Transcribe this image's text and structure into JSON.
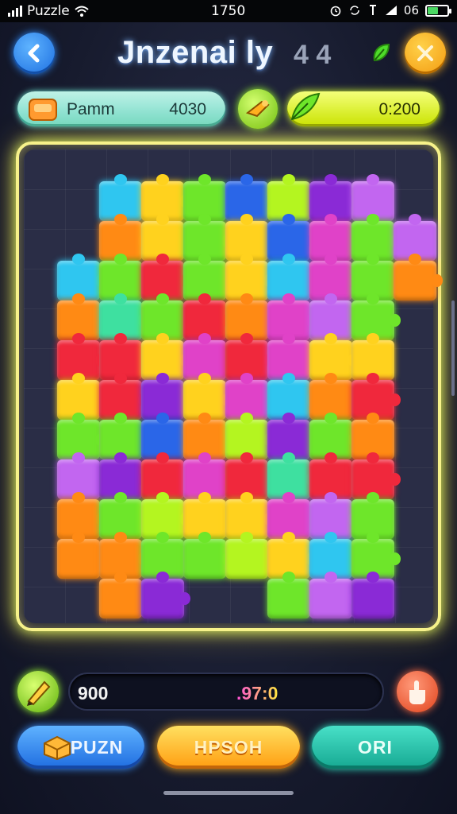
{
  "status_bar": {
    "carrier": "Puzzle",
    "time": "1750",
    "battery_text": "06",
    "battery_level": 0.55
  },
  "header": {
    "title": "Jnzenai ly",
    "title_suffix": "4 4",
    "back_icon": "chevron-left-icon",
    "close_icon": "close-icon"
  },
  "top_panels": {
    "left_label": "Pamm",
    "left_value": "4030",
    "right_value": "0:200",
    "left_icon": "bread-box-icon",
    "middle_icon": "puzzle-hand-icon",
    "right_icon": "leaf-icon"
  },
  "board": {
    "colors": {
      "cyan": "#2fc6f0",
      "yellow": "#ffd21e",
      "green": "#6ee62a",
      "lime": "#b4f520",
      "blue": "#2a66e8",
      "purple": "#8a2ad6",
      "violet": "#c266f0",
      "orange": "#ff8a14",
      "red": "#f0283c",
      "magenta": "#e042c8",
      "mint": "#3ee0a0"
    },
    "rows": [
      [
        "empty",
        "cyan",
        "yellow",
        "green",
        "blue",
        "lime",
        "purple",
        "violet",
        "empty"
      ],
      [
        "empty",
        "orange",
        "yellow",
        "green",
        "yellow",
        "blue",
        "magenta",
        "green",
        "violet"
      ],
      [
        "cyan",
        "green",
        "red",
        "green",
        "yellow",
        "cyan",
        "magenta",
        "green",
        "orange"
      ],
      [
        "orange",
        "mint",
        "green",
        "red",
        "orange",
        "magenta",
        "violet",
        "green",
        "empty"
      ],
      [
        "red",
        "red",
        "yellow",
        "magenta",
        "red",
        "magenta",
        "yellow",
        "yellow",
        "empty"
      ],
      [
        "yellow",
        "red",
        "purple",
        "yellow",
        "magenta",
        "cyan",
        "orange",
        "red",
        "empty"
      ],
      [
        "green",
        "green",
        "blue",
        "orange",
        "lime",
        "purple",
        "green",
        "orange",
        "empty"
      ],
      [
        "violet",
        "purple",
        "red",
        "magenta",
        "red",
        "mint",
        "red",
        "red",
        "empty"
      ],
      [
        "orange",
        "green",
        "lime",
        "yellow",
        "yellow",
        "magenta",
        "violet",
        "green",
        "empty"
      ],
      [
        "orange",
        "orange",
        "green",
        "green",
        "lime",
        "yellow",
        "cyan",
        "green",
        "empty"
      ],
      [
        "empty",
        "orange",
        "purple",
        "empty",
        "empty",
        "green",
        "violet",
        "purple",
        "empty"
      ]
    ]
  },
  "bottom_bar": {
    "score_left": "900",
    "score_right": ".97:0",
    "left_icon": "pencil-icon",
    "right_icon": "hand-icon"
  },
  "actions": {
    "puzn_label": "PUZN",
    "hpsoh_label": "HPSOH",
    "ori_label": "ORI"
  }
}
